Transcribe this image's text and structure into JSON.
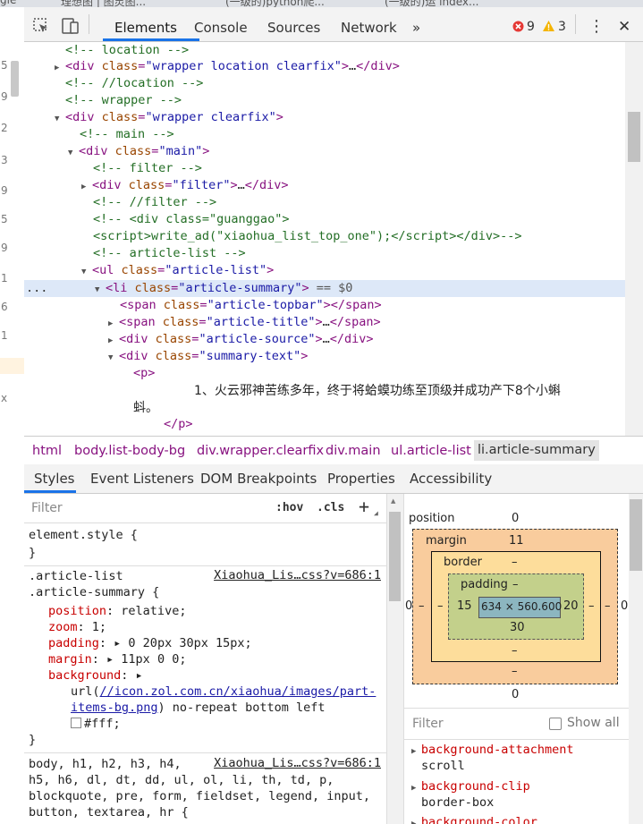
{
  "browser_tabs": [
    "gle",
    "理想图 | 图灵图...",
    "(一级的)python爬...",
    "(一级的)运 index..."
  ],
  "left_gutter_numbers": [
    "5",
    "9",
    "2",
    "3",
    "9",
    "5",
    "9",
    "1",
    "6",
    "1",
    "x"
  ],
  "toolbar": {
    "tabs": [
      "Elements",
      "Console",
      "Sources",
      "Network"
    ],
    "more": "»",
    "errors": "9",
    "warnings": "3",
    "kebab": "⋮",
    "close": "✕"
  },
  "tree": {
    "selected_suffix": "== $0",
    "ellipsis_gutter": "..."
  },
  "breadcrumb": [
    "html",
    "body.list-body-bg",
    "div.wrapper.clearfix",
    "div.main",
    "ul.article-list",
    "li.article-summary"
  ],
  "styles_tabs": [
    "Styles",
    "Event Listeners",
    "DOM Breakpoints",
    "Properties",
    "Accessibility"
  ],
  "styles": {
    "filter_placeholder": "Filter",
    "hov": ":hov",
    "cls": ".cls",
    "plus": "+",
    "element_style": "element.style {",
    "close_brace": "}",
    "rule1_selector_1": ".article-list",
    "rule1_selector_2": ".article-summary {",
    "rule1_source": "Xiaohua_Lis…css?v=686:1",
    "props": [
      {
        "name": "position",
        "value": "relative;"
      },
      {
        "name": "zoom",
        "value": "1;"
      },
      {
        "name": "padding",
        "value": "▸ 0 20px 30px 15px;"
      },
      {
        "name": "margin",
        "value": "▸ 11px 0 0;"
      },
      {
        "name": "background",
        "value": "▸"
      }
    ],
    "bg_url_prefix": "url(",
    "bg_url_link_1": "//icon.zol.com.cn/xiaohua/images/part-",
    "bg_url_link_2": "items-bg.png",
    "bg_url_suffix": ") no-repeat bottom left",
    "bg_color": "#fff;",
    "rule2_source": "Xiaohua_Lis…css?v=686:1",
    "rule2_lines": [
      "body, h1, h2, h3, h4,",
      "h5, h6, dl, dt, dd, ul, ol, li, th, td, p,",
      "blockquote, pre, form, fieldset, legend, input,",
      "button, textarea, hr {"
    ]
  },
  "box_model": {
    "position_label": "position",
    "position_value": "0",
    "margin_label": "margin",
    "margin_top": "11",
    "margin_side": "–",
    "margin_bottom": "–",
    "border_label": "border",
    "border_value": "–",
    "padding_label": "padding",
    "padding_top": "–",
    "padding_left": "15",
    "padding_right": "20",
    "padding_bottom": "30",
    "content": "634 × 560.600",
    "outer_left": "0",
    "outer_right": "0",
    "outer_bottom": "0"
  },
  "computed": {
    "filter_placeholder": "Filter",
    "show_all": "Show all",
    "items": [
      {
        "name": "background-attachment",
        "value": "scroll"
      },
      {
        "name": "background-clip",
        "value": "border-box"
      },
      {
        "name": "background-color",
        "value": ""
      }
    ]
  },
  "colors": {
    "accent": "#1a73e8",
    "selected_row": "#dde8f8",
    "error": "#e53935",
    "warning": "#f4b400"
  }
}
